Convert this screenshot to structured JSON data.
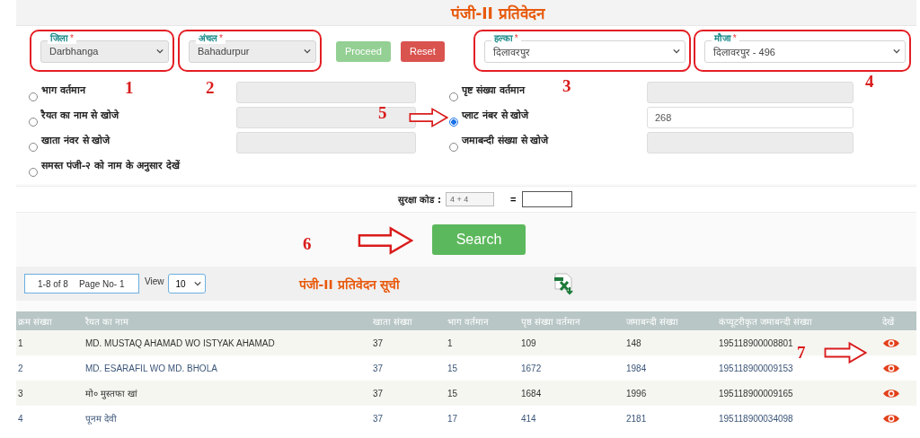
{
  "title": "पंजी-II प्रतिवेदन",
  "filters": [
    {
      "label": "जिला",
      "mark": "*",
      "value": "Darbhanga",
      "disabled": true,
      "circled": true
    },
    {
      "label": "अंचल",
      "mark": "*",
      "value": "Bahadurpur",
      "disabled": true,
      "circled": true
    },
    {
      "label": "हल्का",
      "mark": "*",
      "value": "दिलावरपुर",
      "disabled": false,
      "circled": true
    },
    {
      "label": "मौजा",
      "mark": "*",
      "value": "दिलावरपुर - 496",
      "disabled": false,
      "circled": true
    }
  ],
  "buttons": [
    {
      "label": "Proceed",
      "kind": "proceed",
      "disabled": true
    },
    {
      "label": "Reset",
      "kind": "reset",
      "disabled": false
    }
  ],
  "search_options": [
    {
      "label": "भाग वर्तमान",
      "selected": false,
      "field": {
        "disabled": true
      }
    },
    {
      "label": "पृष्ट संख्या वर्तमान",
      "selected": false,
      "field": {
        "disabled": true
      }
    },
    {
      "label": "रैयत का नाम से खोजे",
      "selected": false,
      "field": {
        "disabled": true
      }
    },
    {
      "label": "प्लाट नंबर से खोजे",
      "selected": true,
      "field": {
        "disabled": false,
        "value": "268"
      }
    },
    {
      "label": "खाता नंवर से खोजे",
      "selected": false,
      "field": {
        "disabled": true
      }
    },
    {
      "label": "जमाबन्दी संख्या से खोजे",
      "selected": false,
      "field": {
        "disabled": true
      }
    },
    {
      "label": "समस्त पंजी-२ को नाम के अनुसार देखें",
      "selected": false
    }
  ],
  "security": {
    "label": "सुरक्षा कोड :",
    "code": "4 + 4",
    "equals": "="
  },
  "search_button": "Search",
  "pager": {
    "range": "1-8 of 8",
    "page": "Page No- 1",
    "view_label": "View",
    "view_value": "10"
  },
  "list_title": "पंजी-II प्रतिवेदन सूची",
  "table": {
    "columns": [
      "क्रम संख्या",
      "रैयत का नाम",
      "खाता संख्या",
      "भाग वर्तमान",
      "पृष्ठ संख्या वर्तमान",
      "जमाबन्दी संख्या",
      "कंप्यूटरीकृत जमाबन्दी संख्या",
      "देखें"
    ],
    "rows": [
      [
        "1",
        "MD. MUSTAQ AHAMAD WO ISTYAK AHAMAD",
        "37",
        "1",
        "109",
        "148",
        "195118900008801"
      ],
      [
        "2",
        "MD. ESARAFIL WO MD. BHOLA",
        "37",
        "15",
        "1672",
        "1984",
        "195118900009153"
      ],
      [
        "3",
        "मो० मुस्तफा खां",
        "37",
        "15",
        "1684",
        "1996",
        "195118900009165"
      ],
      [
        "4",
        "पूनम देवी",
        "37",
        "17",
        "414",
        "2181",
        "195118900034098"
      ]
    ]
  },
  "annotations": [
    {
      "kind": "number",
      "text": "1"
    },
    {
      "kind": "number",
      "text": "2"
    },
    {
      "kind": "number",
      "text": "3"
    },
    {
      "kind": "number",
      "text": "4"
    },
    {
      "kind": "number",
      "text": "5"
    },
    {
      "kind": "arrow"
    },
    {
      "kind": "number",
      "text": "6"
    },
    {
      "kind": "arrow"
    },
    {
      "kind": "number",
      "text": "7"
    },
    {
      "kind": "arrow"
    }
  ]
}
